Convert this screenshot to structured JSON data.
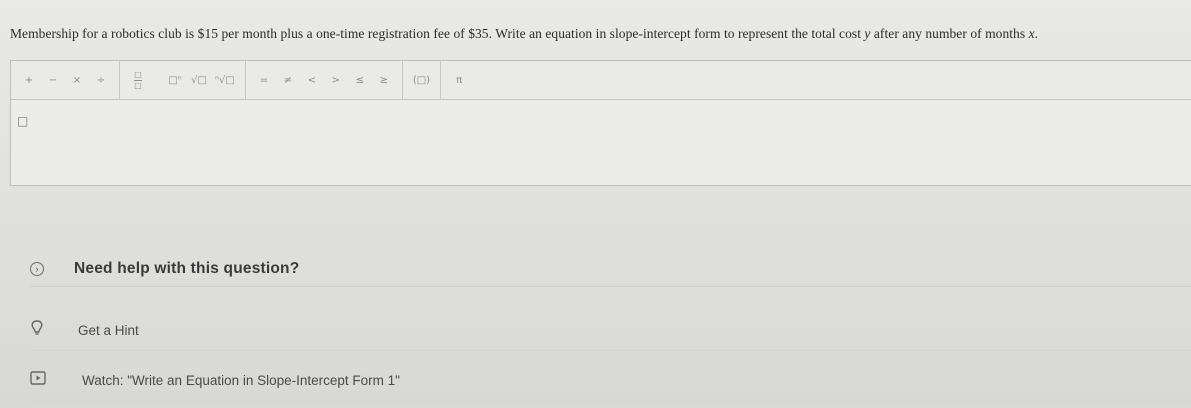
{
  "question": {
    "text_before": "Membership for a robotics club is $15 per month plus a one-time registration fee of $35. Write an equation in slope-intercept form to represent the total cost ",
    "var_y": "y",
    "text_middle": " after any number of months ",
    "var_x": "x",
    "text_end": "."
  },
  "toolbar": {
    "ops": [
      "+",
      "−",
      "×",
      "÷"
    ],
    "fraction": {
      "num": "□",
      "den": "□"
    },
    "exponent": "□ⁿ",
    "sqrt": "√□",
    "nthroot": "ⁿ√□",
    "relations": [
      "=",
      "≠",
      "<",
      ">",
      "≤",
      "≥"
    ],
    "parens": "(□)",
    "pi": "π"
  },
  "answer": {
    "value": "□"
  },
  "help": {
    "label": "Need help with this question?",
    "icon": "chevron-right-icon"
  },
  "hint": {
    "label": "Get a Hint",
    "icon": "lightbulb-icon"
  },
  "watch": {
    "label": "Watch: \"Write an Equation in Slope-Intercept Form 1\"",
    "icon": "video-icon"
  }
}
